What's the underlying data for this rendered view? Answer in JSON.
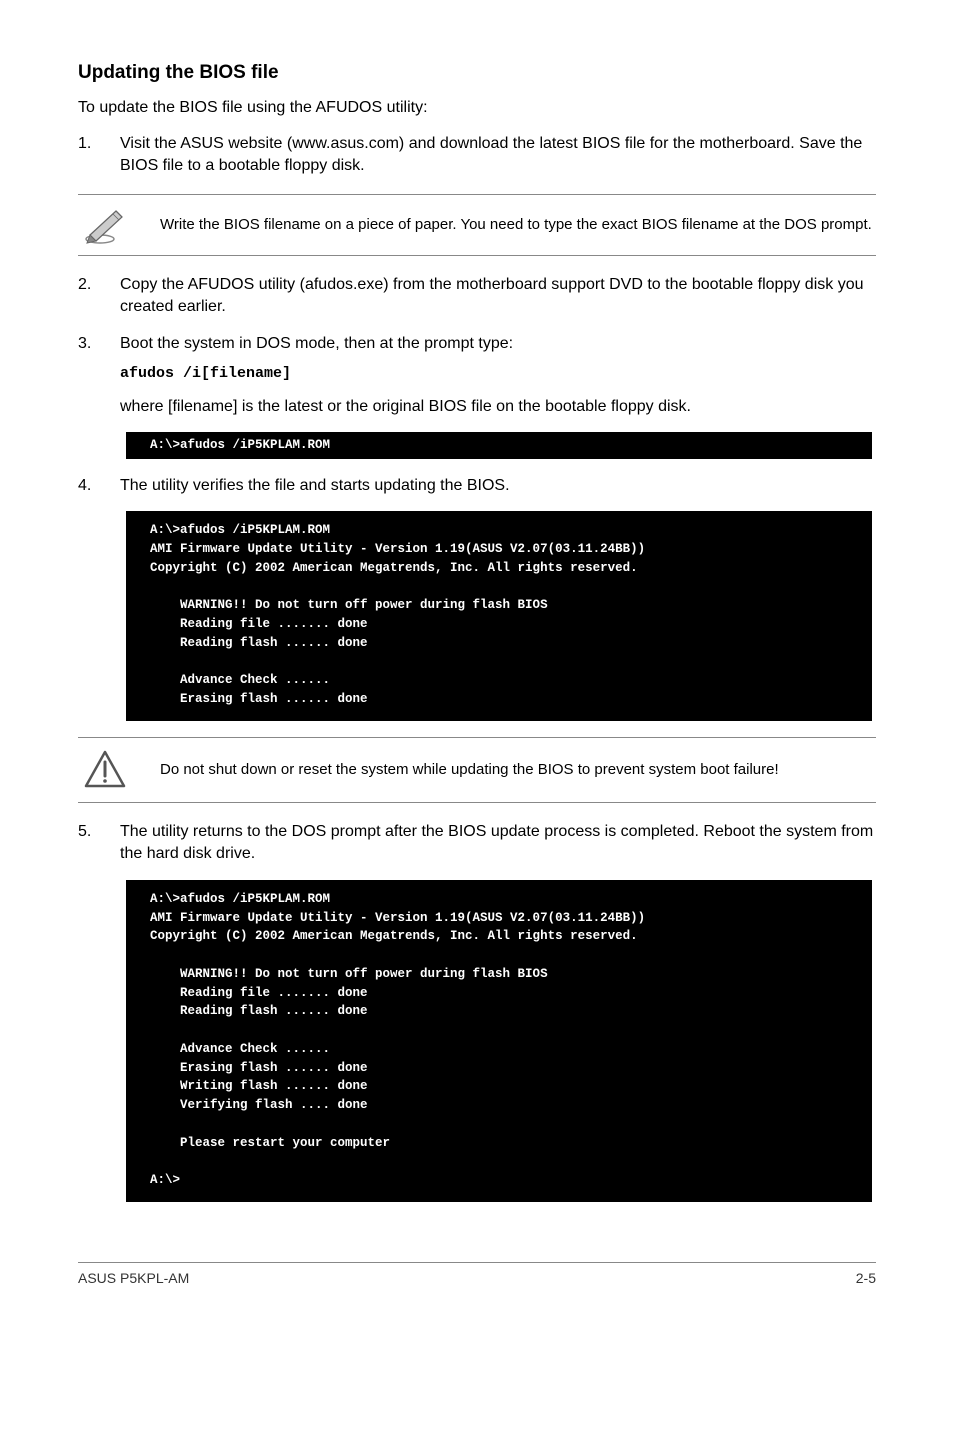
{
  "heading": "Updating the BIOS file",
  "intro": "To update the BIOS file using the AFUDOS utility:",
  "step1": {
    "num": "1.",
    "text": "Visit the ASUS website (www.asus.com) and download the latest BIOS file for the motherboard. Save the BIOS file to a bootable floppy disk."
  },
  "note1": "Write the BIOS filename on a piece of paper. You need to type the exact BIOS filename at the DOS prompt.",
  "step2": {
    "num": "2.",
    "text": "Copy the AFUDOS utility (afudos.exe) from the motherboard support DVD to the bootable floppy disk you created earlier."
  },
  "step3": {
    "num": "3.",
    "text": "Boot the system in DOS mode, then at the prompt type:",
    "code": "afudos /i[filename]",
    "sub": "where [filename] is the latest or the original BIOS file on the bootable floppy disk."
  },
  "terminal1": "A:\\>afudos /iP5KPLAM.ROM",
  "step4": {
    "num": "4.",
    "text": "The utility verifies the file and starts updating the BIOS."
  },
  "terminal2": "A:\\>afudos /iP5KPLAM.ROM\nAMI Firmware Update Utility - Version 1.19(ASUS V2.07(03.11.24BB))\nCopyright (C) 2002 American Megatrends, Inc. All rights reserved.\n\n    WARNING!! Do not turn off power during flash BIOS\n    Reading file ....... done\n    Reading flash ...... done\n\n    Advance Check ......\n    Erasing flash ...... done",
  "note2": "Do not shut down or reset the system while updating the BIOS to prevent system boot failure!",
  "step5": {
    "num": "5.",
    "text": "The utility returns to the DOS prompt after the BIOS update process is completed. Reboot the system from the hard disk drive."
  },
  "terminal3": "A:\\>afudos /iP5KPLAM.ROM\nAMI Firmware Update Utility - Version 1.19(ASUS V2.07(03.11.24BB))\nCopyright (C) 2002 American Megatrends, Inc. All rights reserved.\n\n    WARNING!! Do not turn off power during flash BIOS\n    Reading file ....... done\n    Reading flash ...... done\n\n    Advance Check ......\n    Erasing flash ...... done\n    Writing flash ...... done\n    Verifying flash .... done\n\n    Please restart your computer\n\nA:\\>",
  "footer": {
    "left": "ASUS P5KPL-AM",
    "right": "2-5"
  }
}
